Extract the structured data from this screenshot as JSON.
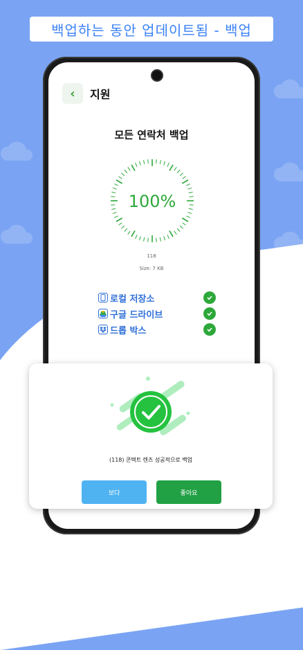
{
  "banner": {
    "text": "백업하는 동안 업데이트됨 - 백업"
  },
  "header": {
    "title": "지원",
    "back_icon": "chevron-left-icon"
  },
  "backup": {
    "headline": "모든 연락처 백업",
    "percent_label": "100%",
    "progress": 1.0,
    "count": "118",
    "size": "Size: 7 KB"
  },
  "services": [
    {
      "label": "로컬 저장소",
      "icon": "phone-storage-icon",
      "done": true
    },
    {
      "label": "구글 드라이브",
      "icon": "google-drive-icon",
      "done": true
    },
    {
      "label": "드롭 박스",
      "icon": "dropbox-icon",
      "done": true
    }
  ],
  "dialog": {
    "message": "(118) 콘택트 렌즈 성공적으로 백업",
    "view_label": "보다",
    "ok_label": "좋아요"
  },
  "colors": {
    "background": "#7aa4f3",
    "accent_green": "#2ea83a",
    "accent_blue": "#2f6fd8",
    "view_button": "#4fb3f2",
    "ok_button": "#21a044"
  }
}
